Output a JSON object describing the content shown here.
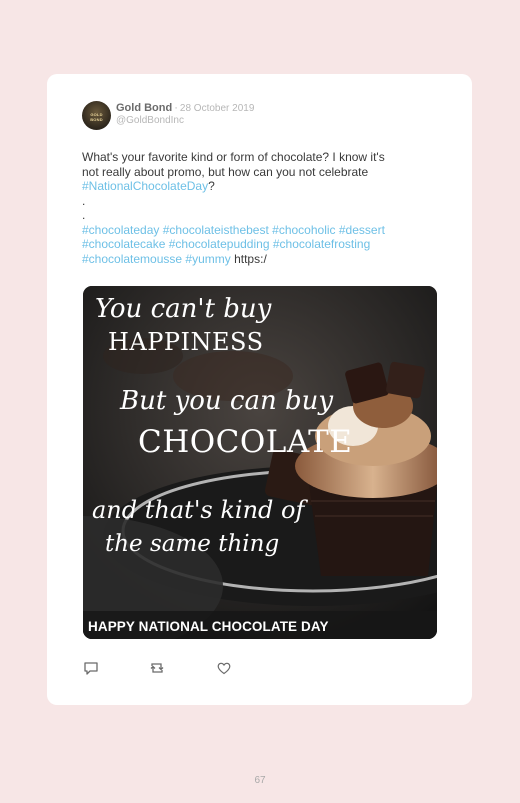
{
  "post": {
    "author_name": "Gold Bond",
    "date": "28 October 2019",
    "handle": "@GoldBondInc",
    "avatar_text": "GOLD BOND",
    "text_line1": "What's your favorite kind or form of chocolate? I know it's",
    "text_line2": "not really about promo, but how can you not celebrate",
    "hashtag_main": "#NationalChocolateDay",
    "question_mark": "?",
    "dot1": ".",
    "dot2": ".",
    "hashtags_line1": [
      "#chocolateday",
      "#chocolateisthebest",
      "#chocoholic",
      "#dessert"
    ],
    "hashtags_line2": [
      "#chocolatecake",
      "#chocolatepudding",
      "#chocolatefrosting"
    ],
    "hashtags_line3": [
      "#chocolatemousse",
      "#yummy"
    ],
    "link": "https:/"
  },
  "image": {
    "quote_line1": "You can't buy",
    "quote_line2": "HAPPINESS",
    "quote_line3": "But you can buy",
    "quote_line4": "CHOCOLATE",
    "quote_line5": "and that's kind of",
    "quote_line6": "the same thing",
    "banner": "HAPPY NATIONAL CHOCOLATE DAY"
  },
  "actions": {
    "reply_icon": "reply-icon",
    "retweet_icon": "retweet-icon",
    "like_icon": "heart-icon"
  },
  "page_number": "67",
  "colors": {
    "background": "#f7e6e6",
    "card": "#ffffff",
    "hashtag": "#6ec0e6",
    "text": "#3a3a3a"
  }
}
